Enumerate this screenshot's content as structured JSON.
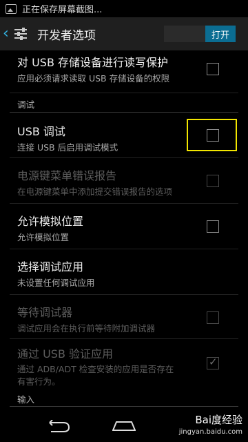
{
  "status_bar": {
    "text": "正在保存屏幕截图..."
  },
  "action_bar": {
    "title": "开发者选项",
    "switch_label": "打开"
  },
  "partial_item": {
    "title": "对 USB 存储设备进行读写保护",
    "summary": "应用必须请求读取 USB 存储设备的权限"
  },
  "section_debug": {
    "label": "调试"
  },
  "items": [
    {
      "title": "USB 调试",
      "summary": "连接 USB 后启用调试模式"
    },
    {
      "title": "电源键菜单错误报告",
      "summary": "在电源键菜单中添加提交错误报告的选项"
    },
    {
      "title": "允许模拟位置",
      "summary": "允许模拟位置"
    },
    {
      "title": "选择调试应用",
      "summary": "未设置任何调试应用"
    },
    {
      "title": "等待调试器",
      "summary": "调试应用会在执行前等待附加调试器"
    },
    {
      "title": "通过 USB 验证应用",
      "summary": "通过 ADB/ADT 检查安装的应用是否存在",
      "summary2": "有害行为。"
    }
  ],
  "section_input": {
    "label": "输入"
  },
  "watermark": {
    "text": "Bai度经验",
    "sub": "jingyan.baidu.com"
  }
}
